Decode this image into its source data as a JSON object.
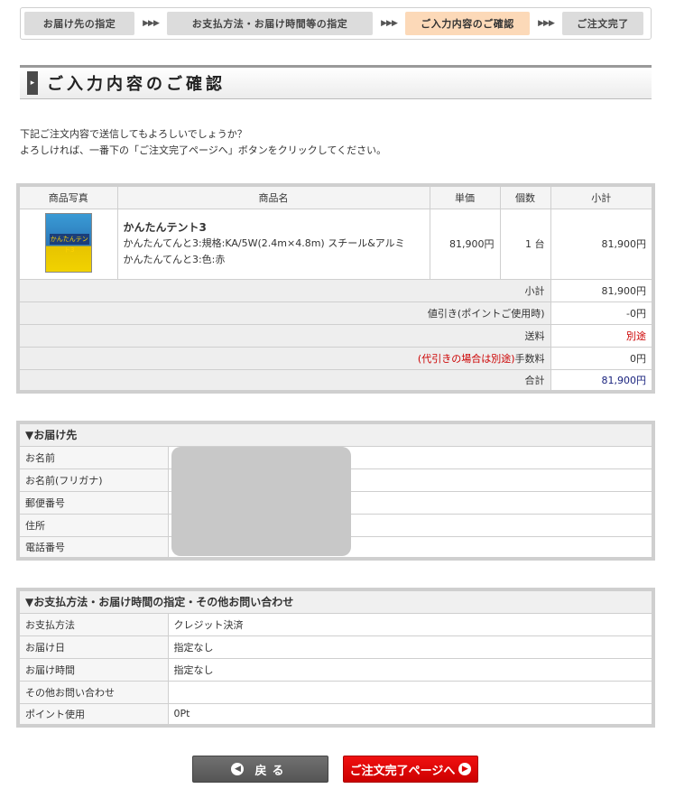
{
  "steps": [
    {
      "label": "お届け先の指定"
    },
    {
      "label": "お支払方法・お届け時間等の指定"
    },
    {
      "label": "ご入力内容のご確認"
    },
    {
      "label": "ご注文完了"
    }
  ],
  "step_arrow": "▶▶▶",
  "heading": "ご入力内容のご確認",
  "intro": {
    "line1": "下記ご注文内容で送信してもよろしいでしょうか？",
    "line2": "よろしければ、一番下の「ご注文完了ページへ」ボタンをクリックしてください。"
  },
  "order": {
    "headers": {
      "photo": "商品写真",
      "name": "商品名",
      "price": "単価",
      "qty": "個数",
      "subtotal": "小計"
    },
    "item": {
      "image_caption": "かんたんテント3",
      "name": "かんたんテント3",
      "spec1": "かんたんてんと3:規格:KA/5W(2.4m×4.8m) スチール&アルミ",
      "spec2": "かんたんてんと3:色:赤",
      "price": "81,900円",
      "qty": "1 台",
      "subtotal": "81,900円"
    },
    "summary": {
      "subtotal_label": "小計",
      "subtotal": "81,900円",
      "discount_label": "値引き(ポイントご使用時)",
      "discount": "-0円",
      "shipping_label": "送料",
      "shipping": "別途",
      "fee_note": "(代引きの場合は別途)",
      "fee_label": "手数料",
      "fee": "0円",
      "total_label": "合計",
      "total": "81,900円"
    }
  },
  "delivery": {
    "title": "▼お届け先",
    "rows": [
      {
        "label": "お名前"
      },
      {
        "label": "お名前(フリガナ)"
      },
      {
        "label": "郵便番号"
      },
      {
        "label": "住所"
      },
      {
        "label": "電話番号"
      }
    ]
  },
  "payment": {
    "title": "▼お支払方法・お届け時間の指定・その他お問い合わせ",
    "rows": [
      {
        "label": "お支払方法",
        "value": "クレジット決済"
      },
      {
        "label": "お届け日",
        "value": "指定なし"
      },
      {
        "label": "お届け時間",
        "value": "指定なし"
      },
      {
        "label": "その他お問い合わせ",
        "value": ""
      },
      {
        "label": "ポイント使用",
        "value": "0Pt"
      }
    ]
  },
  "buttons": {
    "back": "戻る",
    "next": "ご注文完了ページへ"
  },
  "colors": {
    "active_step": "#fcd9b8",
    "accent_red": "#cc0000",
    "total_blue": "#1a237e"
  }
}
